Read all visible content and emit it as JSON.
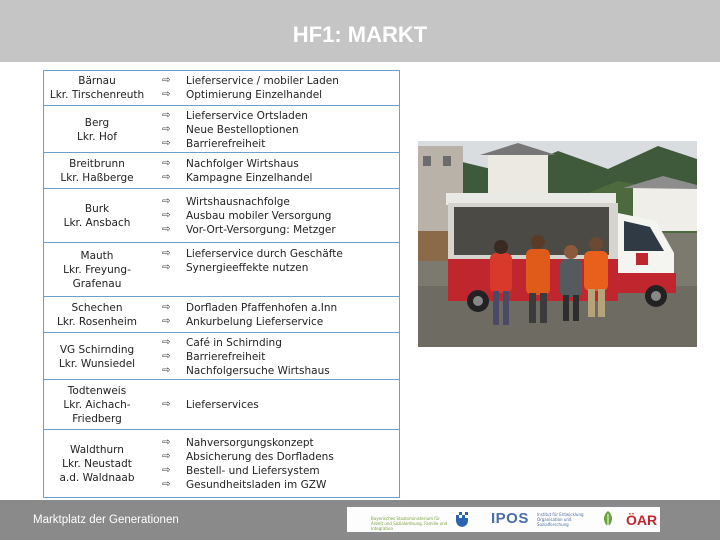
{
  "header": {
    "title": "HF1: MARKT"
  },
  "rows": [
    {
      "location": [
        "Bärnau",
        "Lkr. Tirschenreuth"
      ],
      "items": [
        "Lieferservice / mobiler Laden",
        "Optimierung Einzelhandel"
      ]
    },
    {
      "location": [
        "Berg",
        "Lkr. Hof"
      ],
      "items": [
        "Lieferservice Ortsladen",
        "Neue Bestelloptionen",
        "Barrierefreiheit"
      ]
    },
    {
      "location": [
        "Breitbrunn",
        "Lkr. Haßberge"
      ],
      "items": [
        "Nachfolger Wirtshaus",
        "Kampagne Einzelhandel"
      ]
    },
    {
      "location": [
        "Burk",
        "Lkr. Ansbach"
      ],
      "items": [
        "Wirtshausnachfolge",
        "Ausbau mobiler Versorgung",
        "Vor-Ort-Versorgung: Metzger"
      ]
    },
    {
      "location": [
        "Mauth",
        "Lkr. Freyung-",
        "Grafenau"
      ],
      "items": [
        "Lieferservice durch Geschäfte",
        "Synergieeffekte nutzen"
      ]
    },
    {
      "location": [
        "Schechen",
        "Lkr. Rosenheim"
      ],
      "items": [
        "Dorfladen Pfaffenhofen a.Inn",
        "Ankurbelung Lieferservice"
      ]
    },
    {
      "location": [
        "VG Schirnding",
        "Lkr. Wunsiedel"
      ],
      "items": [
        "Café in Schirnding",
        "Barrierefreiheit",
        "Nachfolgersuche Wirtshaus"
      ]
    },
    {
      "location": [
        "Todtenweis",
        "Lkr. Aichach-",
        "Friedberg"
      ],
      "items": [
        "Lieferservices"
      ]
    },
    {
      "location": [
        "Waldthurn",
        "Lkr. Neustadt",
        "a.d. Waldnaab"
      ],
      "items": [
        "Nahversorgungskonzept",
        "Absicherung des Dorfladens",
        "Bestell- und Liefersystem",
        "Gesundheitsladen im GZW"
      ]
    }
  ],
  "arrow_icon": "⇨",
  "footer": {
    "text": "Marktplatz der Generationen",
    "logos": {
      "ministry": "Bayerisches Staatsministerium für Arbeit und Sozialordnung, Familie und Integration",
      "ipos": "IPOS",
      "institute": "Institut für Entwicklung Organisation und Sozialforschung",
      "oar": "ÖAR"
    }
  },
  "photo": {
    "subject": "mobile-shop-van"
  },
  "colors": {
    "header_bg": "#c5c5c5",
    "footer_bg": "#8a8a8a",
    "table_border": "#6f9fc8"
  }
}
